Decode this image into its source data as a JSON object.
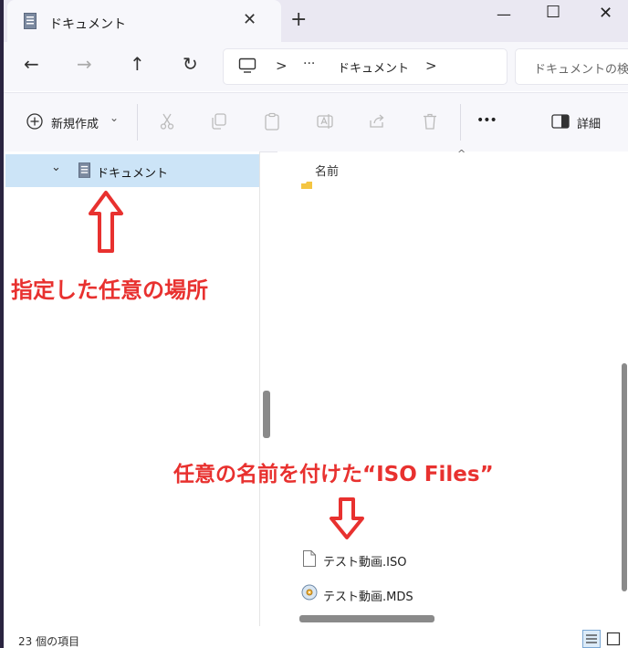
{
  "window": {
    "tab_title": "ドキュメント",
    "tab_close": "✕",
    "new_tab": "+",
    "minimize": "—",
    "maximize": "☐",
    "close": "✕"
  },
  "nav": {
    "back": "←",
    "forward": "→",
    "up": "↑",
    "refresh": "↻",
    "breadcrumb_sep1": ">",
    "breadcrumb_more": "···",
    "breadcrumb_folder": "ドキュメント",
    "breadcrumb_sep2": ">",
    "search_placeholder": "ドキュメントの検索"
  },
  "command_bar": {
    "new_label": "新規作成",
    "new_caret": "⌄",
    "more": "•••",
    "details_label": "詳細"
  },
  "sidebar": {
    "selected_item": "ドキュメント",
    "selected_caret": "⌄"
  },
  "content": {
    "column_name": "名前",
    "sort_indicator": "^",
    "files": [
      {
        "name": "テスト動画.ISO",
        "icon": "document-icon"
      },
      {
        "name": "テスト動画.MDS",
        "icon": "disc-image-icon"
      }
    ]
  },
  "status": {
    "item_count": "23 個の項目"
  },
  "annotations": {
    "location_label": "指定した任意の場所",
    "files_label": "任意の名前を付けた“ISO Files”"
  },
  "colors": {
    "accent_red": "#e8312f",
    "selection": "#cce4f7"
  }
}
